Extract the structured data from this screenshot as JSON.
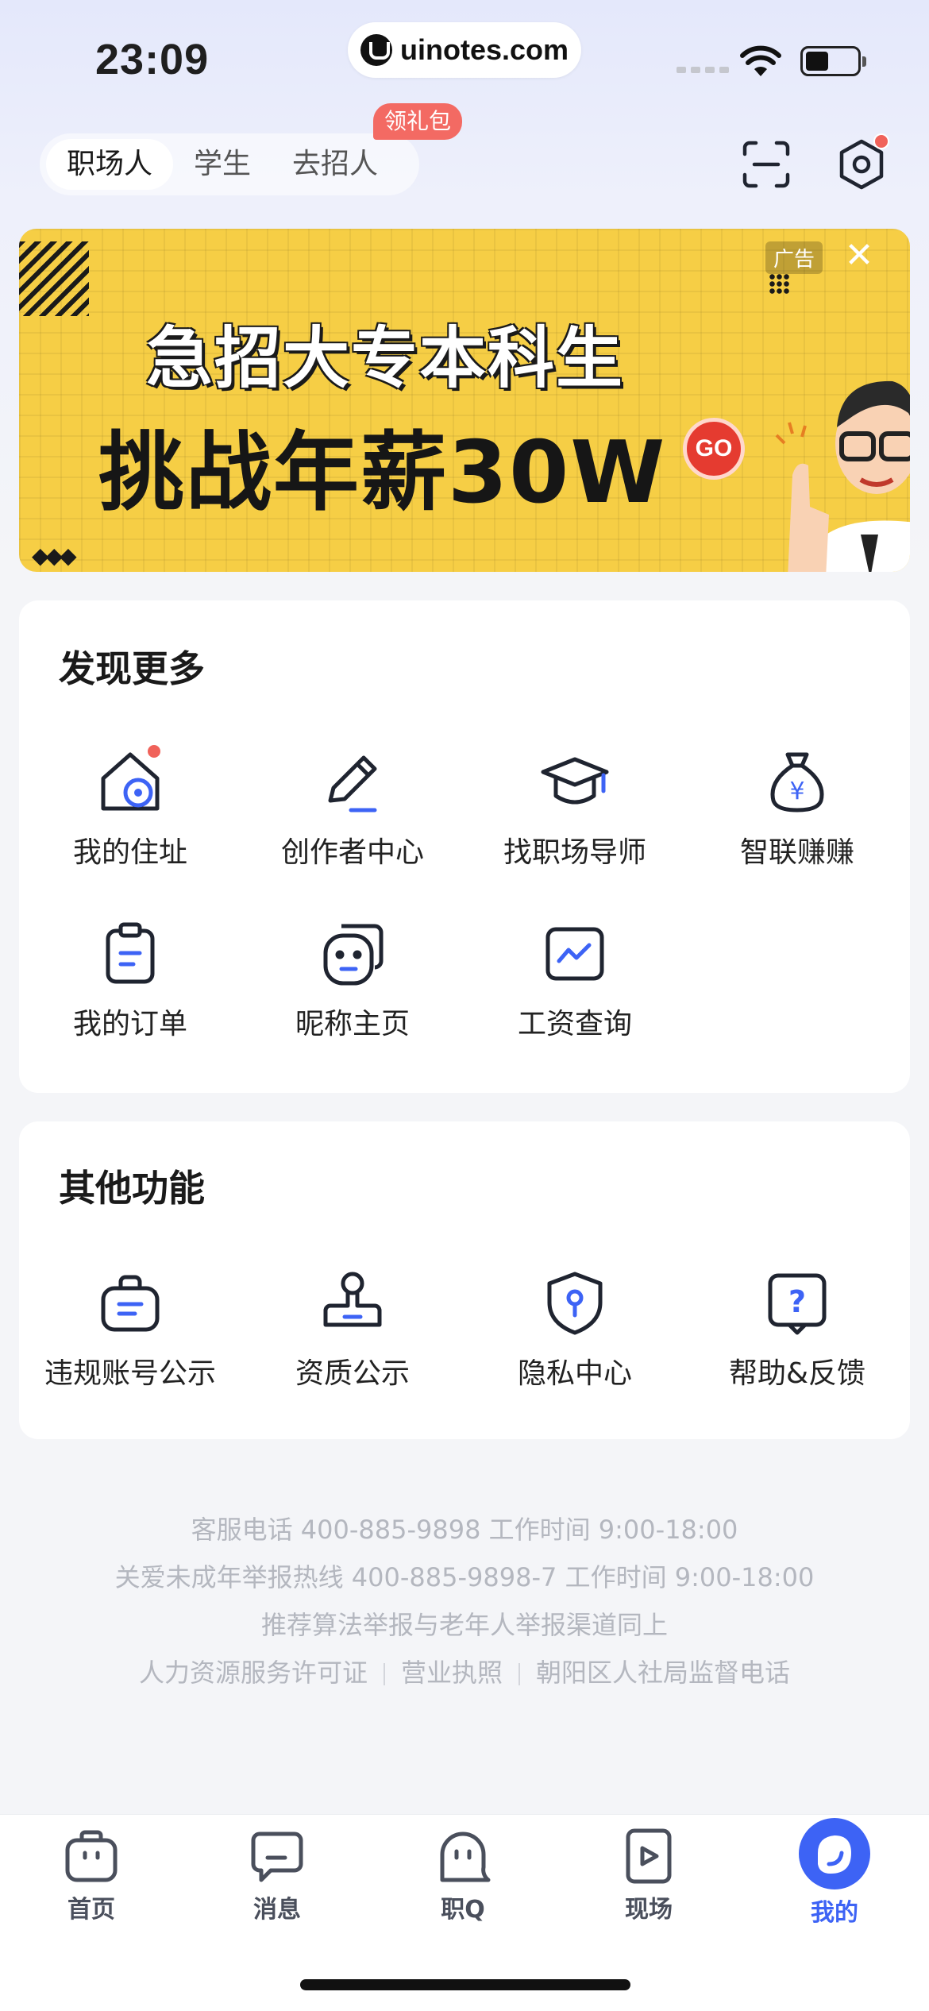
{
  "status_bar": {
    "time": "23:09",
    "url": "uinotes.com"
  },
  "role_tabs": {
    "items": [
      "职场人",
      "学生",
      "去招人"
    ],
    "active_index": 0,
    "gift_badge": "领礼包"
  },
  "banner": {
    "line1": "急招大专本科生",
    "line2": "挑战年薪30W",
    "go_label": "GO",
    "ad_label": "广告",
    "close_glyph": "✕",
    "colors": {
      "background": "#f6ce45",
      "accent": "#e53b30"
    }
  },
  "discover": {
    "title": "发现更多",
    "items": [
      {
        "label": "我的住址",
        "icon": "home-location-icon",
        "has_dot": true
      },
      {
        "label": "创作者中心",
        "icon": "pencil-icon"
      },
      {
        "label": "找职场导师",
        "icon": "graduation-cap-icon"
      },
      {
        "label": "智联赚赚",
        "icon": "money-bag-icon",
        "glyph": "¥"
      },
      {
        "label": "我的订单",
        "icon": "clipboard-icon"
      },
      {
        "label": "昵称主页",
        "icon": "smile-face-icon"
      },
      {
        "label": "工资查询",
        "icon": "line-chart-icon"
      }
    ]
  },
  "other": {
    "title": "其他功能",
    "items": [
      {
        "label": "违规账号公示",
        "icon": "notice-bag-icon"
      },
      {
        "label": "资质公示",
        "icon": "stamp-icon"
      },
      {
        "label": "隐私中心",
        "icon": "shield-lock-icon"
      },
      {
        "label": "帮助&反馈",
        "icon": "help-question-icon",
        "glyph": "?"
      }
    ]
  },
  "footer": {
    "line1": "客服电话 400-885-9898  工作时间 9:00-18:00",
    "line2": "关爱未成年举报热线 400-885-9898-7  工作时间 9:00-18:00",
    "line3": "推荐算法举报与老年人举报渠道同上",
    "links": [
      "人力资源服务许可证",
      "营业执照",
      "朝阳区人社局监督电话"
    ]
  },
  "tab_bar": {
    "items": [
      {
        "label": "首页",
        "icon": "briefcase-icon"
      },
      {
        "label": "消息",
        "icon": "chat-bubble-icon"
      },
      {
        "label": "职Q",
        "icon": "ghost-icon"
      },
      {
        "label": "现场",
        "icon": "play-icon"
      },
      {
        "label": "我的",
        "icon": "profile-icon"
      }
    ],
    "active_index": 4,
    "colors": {
      "active": "#3d63f5",
      "inactive": "#4a4f5c"
    }
  }
}
